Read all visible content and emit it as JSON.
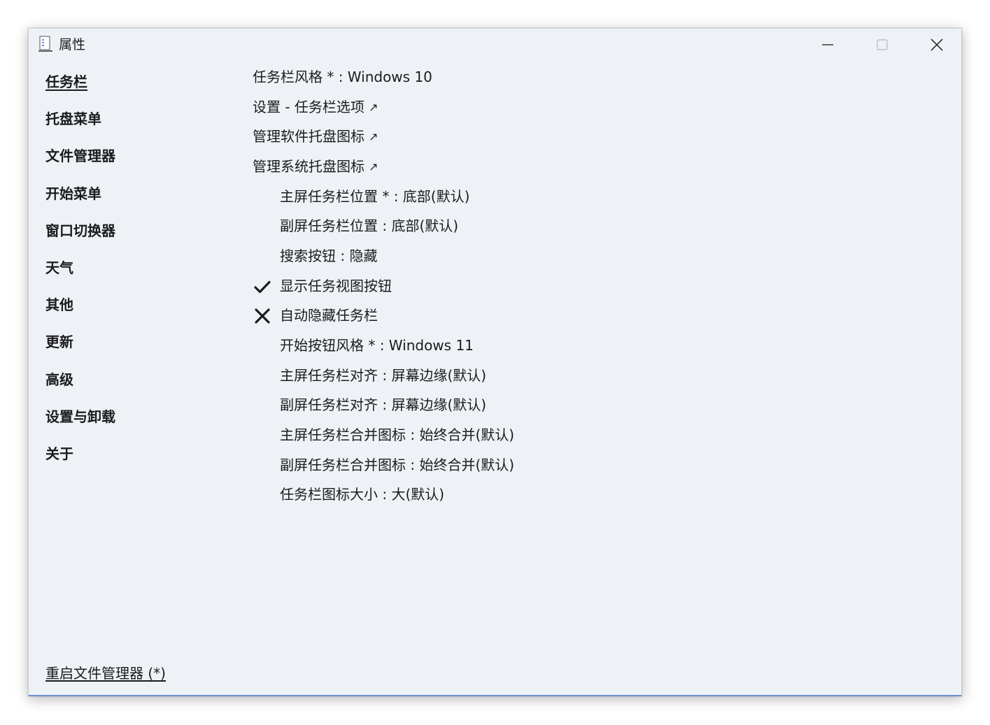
{
  "window": {
    "title": "属性"
  },
  "sidebar": {
    "items": [
      {
        "label": "任务栏",
        "active": true
      },
      {
        "label": "托盘菜单",
        "active": false
      },
      {
        "label": "文件管理器",
        "active": false
      },
      {
        "label": "开始菜单",
        "active": false
      },
      {
        "label": "窗口切换器",
        "active": false
      },
      {
        "label": "天气",
        "active": false
      },
      {
        "label": "其他",
        "active": false
      },
      {
        "label": "更新",
        "active": false
      },
      {
        "label": "高级",
        "active": false
      },
      {
        "label": "设置与卸载",
        "active": false
      },
      {
        "label": "关于",
        "active": false
      }
    ],
    "footer_link": "重启文件管理器 (*)"
  },
  "content": {
    "taskbar_style": "任务栏风格 * : Windows 10",
    "settings_link": "设置 - 任务栏选项",
    "manage_app_tray_link": "管理软件托盘图标",
    "manage_system_tray_link": "管理系统托盘图标",
    "external_arrow": "↗",
    "primary_position": "主屏任务栏位置 * : 底部(默认)",
    "secondary_position": "副屏任务栏位置 : 底部(默认)",
    "search_button": "搜索按钮 : 隐藏",
    "show_task_view": {
      "label": "显示任务视图按钮",
      "checked": true
    },
    "auto_hide": {
      "label": "自动隐藏任务栏",
      "checked": false
    },
    "start_button_style": "开始按钮风格 * : Windows 11",
    "primary_alignment": "主屏任务栏对齐 : 屏幕边缘(默认)",
    "secondary_alignment": "副屏任务栏对齐 : 屏幕边缘(默认)",
    "primary_combine": "主屏任务栏合并图标 : 始终合并(默认)",
    "secondary_combine": "副屏任务栏合并图标 : 始终合并(默认)",
    "icon_size": "任务栏图标大小 : 大(默认)"
  },
  "colors": {
    "window_bg": "#eef2f7",
    "text": "#1b1b1b",
    "accent_border": "#6b8fd0"
  }
}
